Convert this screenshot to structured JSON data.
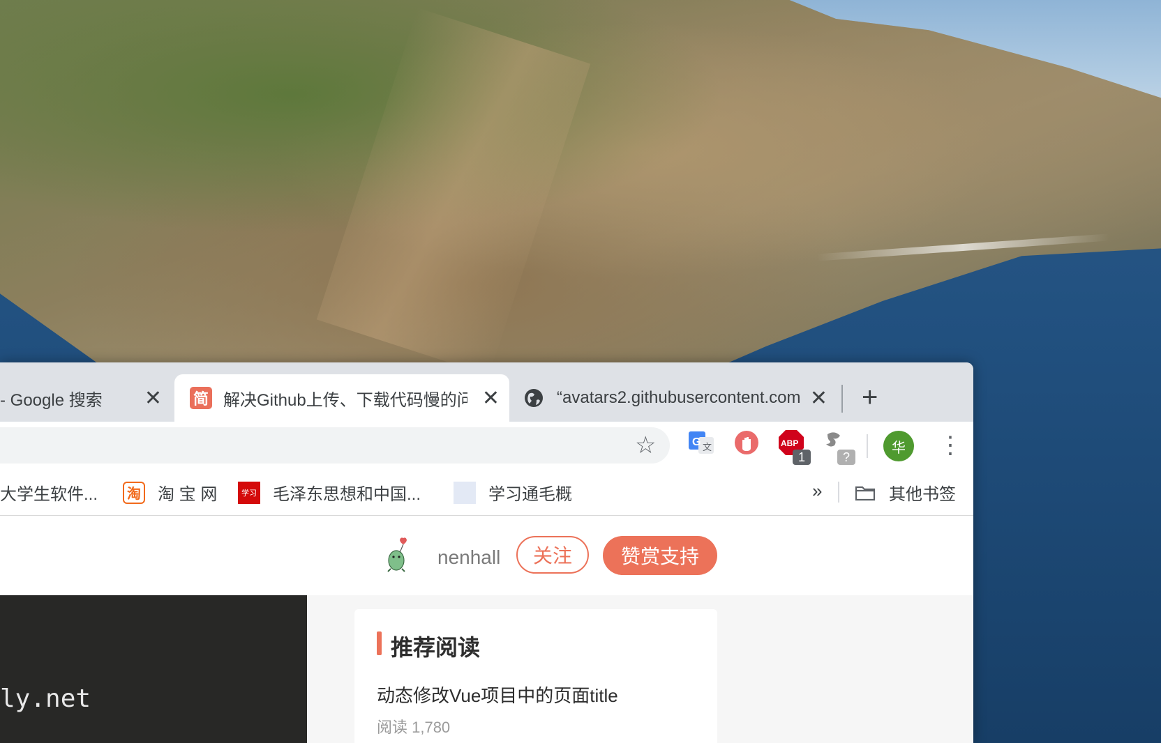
{
  "tabs": [
    {
      "title": "- Google 搜索",
      "close": "✕",
      "active": false
    },
    {
      "title": "解决Github上传、下载代码慢的问",
      "favicon_text": "简",
      "close": "✕",
      "active": true
    },
    {
      "title": "“avatars2.githubusercontent.com",
      "favicon": "globe-icon",
      "close": "✕",
      "active": false
    }
  ],
  "new_tab_label": "+",
  "toolbar": {
    "bookmark_star": "☆",
    "profile_initial": "华",
    "menu": "⋮",
    "extensions": [
      {
        "name": "google-translate-icon"
      },
      {
        "name": "hand-stop-icon"
      },
      {
        "name": "adblock-icon",
        "label": "ABP",
        "badge": "1"
      },
      {
        "name": "extension-unknown-icon",
        "badge": "?"
      }
    ]
  },
  "bookmarks": {
    "items": [
      {
        "label": "大学生软件..."
      },
      {
        "label": "淘 宝 网",
        "icon_text": "淘"
      },
      {
        "label": "毛泽东思想和中国...",
        "icon_text": "学习"
      },
      {
        "label": "学习通毛概"
      }
    ],
    "more": "»",
    "other": "其他书签"
  },
  "author": {
    "name": "nenhall",
    "follow": "关注",
    "tip": "赞赏支持"
  },
  "code": {
    "line": "ly.net"
  },
  "recommend": {
    "heading": "推荐阅读",
    "items": [
      {
        "title": "动态修改Vue项目中的页面title",
        "meta": "阅读 1,780"
      }
    ]
  },
  "colors": {
    "brand": "#ec7259",
    "tabstrip": "#dee1e6",
    "profile": "#4f9a2f"
  }
}
